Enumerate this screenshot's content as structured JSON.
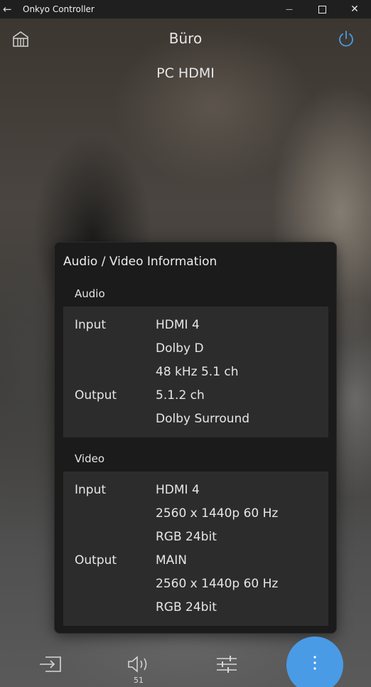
{
  "window": {
    "title": "Onkyo Controller",
    "back_glyph": "←",
    "minimize_glyph": "—",
    "close_glyph": "✕"
  },
  "header": {
    "room": "Büro",
    "source": "PC HDMI",
    "home_icon": "home-icon",
    "power_icon": "power-icon",
    "power_color": "#4a9be6"
  },
  "dialog": {
    "title": "Audio / Video Information",
    "audio": {
      "label": "Audio",
      "rows": [
        {
          "key": "Input",
          "value": "HDMI 4"
        },
        {
          "key": "",
          "value": "Dolby D"
        },
        {
          "key": "",
          "value": "48 kHz  5.1 ch"
        },
        {
          "key": "Output",
          "value": "5.1.2 ch"
        },
        {
          "key": "",
          "value": "Dolby Surround"
        }
      ]
    },
    "video": {
      "label": "Video",
      "rows": [
        {
          "key": "Input",
          "value": "HDMI 4"
        },
        {
          "key": "",
          "value": "2560 x 1440p  60 Hz"
        },
        {
          "key": "",
          "value": "RGB  24bit"
        },
        {
          "key": "Output",
          "value": "MAIN"
        },
        {
          "key": "",
          "value": "2560 x 1440p  60 Hz"
        },
        {
          "key": "",
          "value": "RGB  24bit"
        }
      ]
    }
  },
  "bottom_bar": {
    "input_icon": "input-select-icon",
    "volume_icon": "speaker-icon",
    "volume_level": "51",
    "settings_icon": "sliders-icon",
    "more_icon": "more-vertical-icon",
    "fab_color": "#4a9be6"
  }
}
